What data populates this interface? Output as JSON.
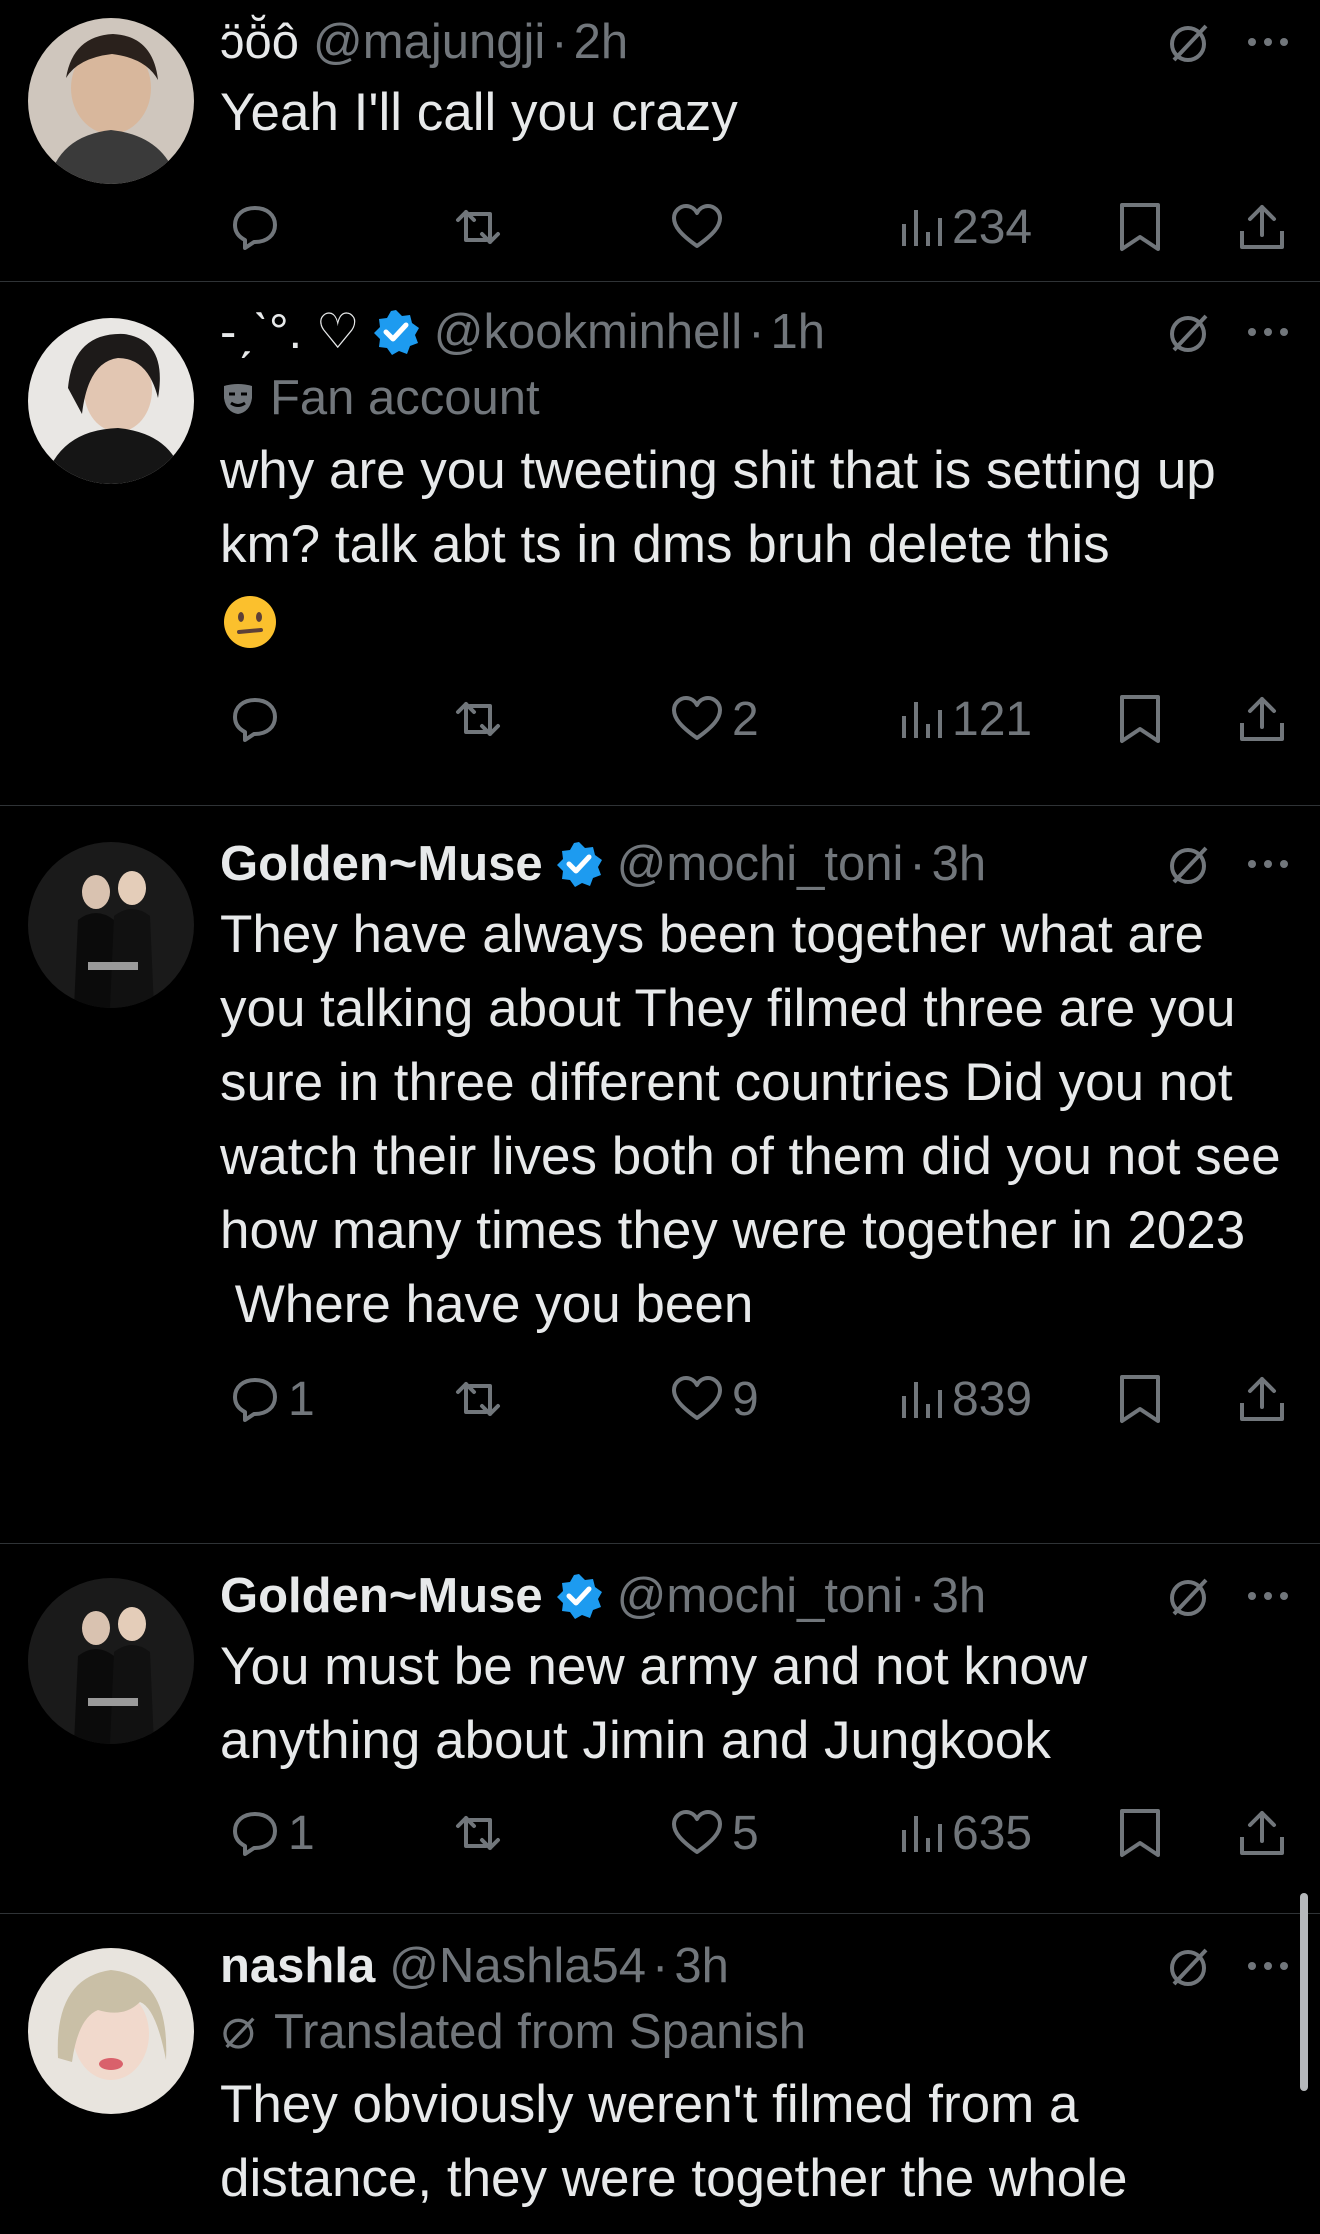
{
  "tweets": [
    {
      "display_name": "ɔ̈ö̆ô",
      "handle": "@majungji",
      "time": "2h",
      "verified": false,
      "label": "",
      "text": "Yeah I'll call you crazy",
      "replies": "",
      "likes": "",
      "views": "234"
    },
    {
      "display_name": "-ˏˋ°. ♡",
      "handle": "@kookminhell",
      "time": "1h",
      "verified": true,
      "label": "Fan account",
      "text": "why are you tweeting shit that is setting up km? talk abt ts in dms bruh delete this",
      "replies": "",
      "likes": "2",
      "views": "121"
    },
    {
      "display_name": "Golden~Muse",
      "handle": "@mochi_toni",
      "time": "3h",
      "verified": true,
      "label": "",
      "text": "They have always been together what are you talking about They filmed three are you sure in three different countries Did you not watch their lives both of them did you not see how many times they were together in 2023\n Where have you been",
      "replies": "1",
      "likes": "9",
      "views": "839"
    },
    {
      "display_name": "Golden~Muse",
      "handle": "@mochi_toni",
      "time": "3h",
      "verified": true,
      "label": "",
      "text": "You must be new army and not know anything about Jimin and Jungkook",
      "replies": "1",
      "likes": "5",
      "views": "635"
    },
    {
      "display_name": "nashla",
      "handle": "@Nashla54",
      "time": "3h",
      "verified": false,
      "label": "Translated from Spanish",
      "text": "They obviously weren't filmed from a distance, they were together the whole",
      "replies": "",
      "likes": "",
      "views": ""
    }
  ],
  "separator": "·",
  "colors": {
    "background": "#000000",
    "text": "#e7e9ea",
    "muted": "#71767b",
    "verified": "#1d9bf0",
    "divider": "#2f3336"
  },
  "icons": [
    "reply-icon",
    "repost-icon",
    "like-icon",
    "views-icon",
    "bookmark-icon",
    "share-icon",
    "grok-icon",
    "more-icon",
    "verified-badge-icon",
    "fan-account-mask-icon",
    "translate-icon"
  ]
}
